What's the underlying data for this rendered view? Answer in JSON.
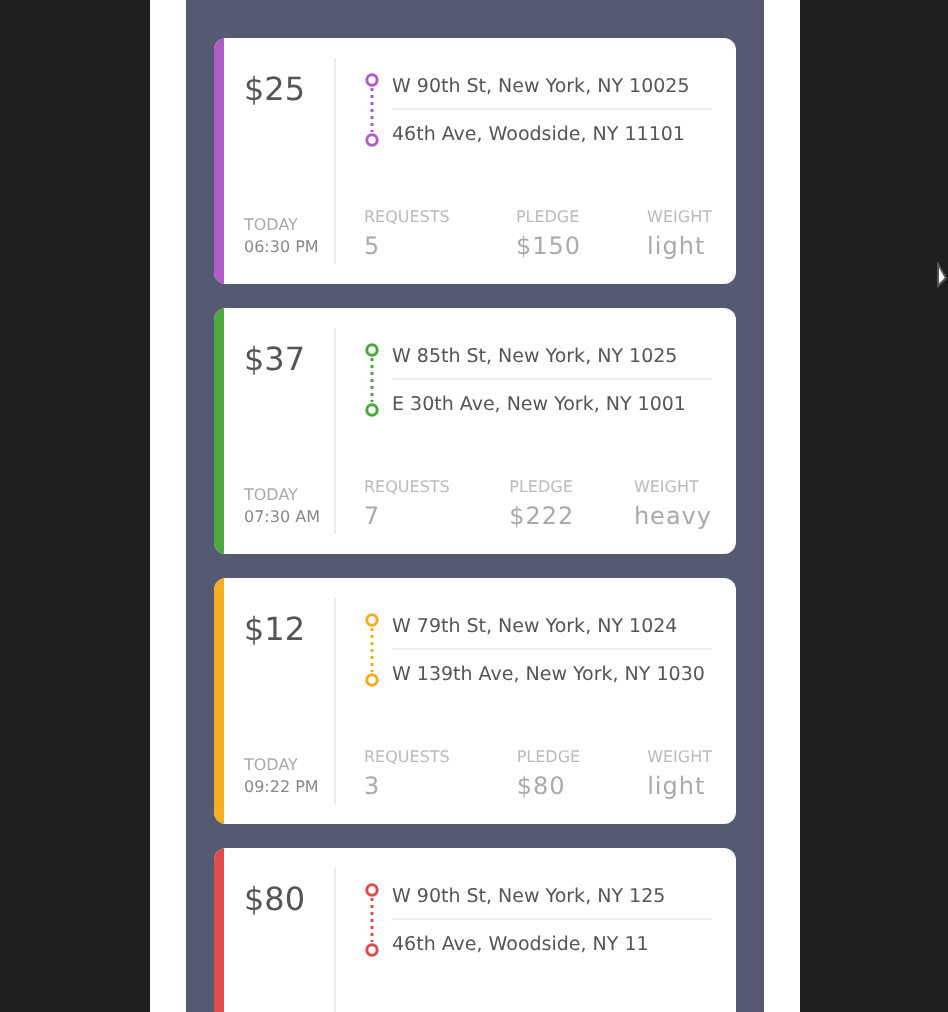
{
  "orders": [
    {
      "price": "$25",
      "color": "#b05cc8",
      "from": "W 90th St, New York, NY 10025",
      "to": "46th Ave, Woodside, NY 11101",
      "day": "TODAY",
      "time": "06:30 PM",
      "stats": [
        {
          "label": "REQUESTS",
          "value": "5"
        },
        {
          "label": "PLEDGE",
          "value": "$150"
        },
        {
          "label": "WEIGHT",
          "value": "light"
        }
      ]
    },
    {
      "price": "$37",
      "color": "#4caa3c",
      "from": "W 85th St, New York, NY 1025",
      "to": "E 30th Ave, New York, NY 1001",
      "day": "TODAY",
      "time": "07:30 AM",
      "stats": [
        {
          "label": "REQUESTS",
          "value": "7"
        },
        {
          "label": "PLEDGE",
          "value": "$222"
        },
        {
          "label": "WEIGHT",
          "value": "heavy"
        }
      ]
    },
    {
      "price": "$12",
      "color": "#f4ae22",
      "from": "W 79th St, New York, NY 1024",
      "to": "W 139th Ave, New York, NY 1030",
      "day": "TODAY",
      "time": "09:22 PM",
      "stats": [
        {
          "label": "REQUESTS",
          "value": "3"
        },
        {
          "label": "PLEDGE",
          "value": "$80"
        },
        {
          "label": "WEIGHT",
          "value": "light"
        }
      ]
    },
    {
      "price": "$80",
      "color": "#e24b4b",
      "from": "W 90th St, New York, NY 125",
      "to": "46th Ave, Woodside, NY 11"
    }
  ]
}
